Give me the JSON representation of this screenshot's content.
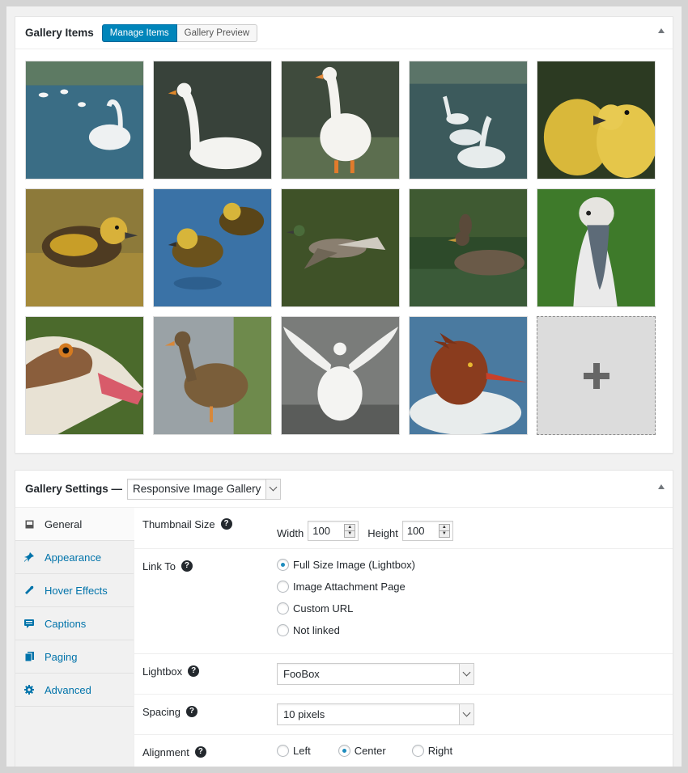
{
  "gallery_items": {
    "title": "Gallery Items",
    "tabs": [
      {
        "label": "Manage Items",
        "active": true
      },
      {
        "label": "Gallery Preview",
        "active": false
      }
    ],
    "add_icon": "plus-icon"
  },
  "gallery_settings": {
    "title": "Gallery Settings —",
    "template_select": "Responsive Image Gallery",
    "nav": [
      {
        "label": "General",
        "icon": "general-icon"
      },
      {
        "label": "Appearance",
        "icon": "pin-icon"
      },
      {
        "label": "Hover Effects",
        "icon": "wrench-icon"
      },
      {
        "label": "Captions",
        "icon": "comment-icon"
      },
      {
        "label": "Paging",
        "icon": "pages-icon"
      },
      {
        "label": "Advanced",
        "icon": "gear-icon"
      }
    ],
    "thumbnail": {
      "label": "Thumbnail Size",
      "width_label": "Width",
      "width": "100",
      "height_label": "Height",
      "height": "100"
    },
    "link_to": {
      "label": "Link To",
      "options": [
        "Full Size Image (Lightbox)",
        "Image Attachment Page",
        "Custom URL",
        "Not linked"
      ],
      "selected": 0
    },
    "lightbox": {
      "label": "Lightbox",
      "value": "FooBox"
    },
    "spacing": {
      "label": "Spacing",
      "value": "10 pixels"
    },
    "alignment": {
      "label": "Alignment",
      "options": [
        "Left",
        "Center",
        "Right"
      ],
      "selected": 1
    }
  },
  "colors": {
    "accent": "#0085ba",
    "link": "#0073aa"
  }
}
